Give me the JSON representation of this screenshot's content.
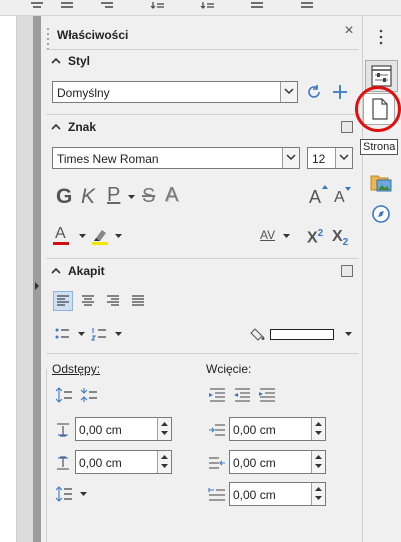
{
  "panel": {
    "title": "Właściwości",
    "close_glyph": "×"
  },
  "style_section": {
    "title": "Styl",
    "style_value": "Domyślny"
  },
  "char_section": {
    "title": "Znak",
    "font_name": "Times New Roman",
    "font_size": "12",
    "glyph_bold": "G",
    "glyph_italic": "K",
    "glyph_underline": "P",
    "glyph_strike": "S",
    "glyph_shadow": "A",
    "glyph_grow": "A",
    "glyph_shrink": "A",
    "glyph_fontcolor": "A",
    "glyph_spacing": "AV",
    "glyph_super": "X",
    "super_mark": "2",
    "glyph_sub": "X",
    "sub_mark": "2"
  },
  "para_section": {
    "title": "Akapit",
    "spacing_label": "Odstępy:",
    "indent_label": "Wcięcie:",
    "above_value": "0,00 cm",
    "below_value": "0,00 cm",
    "before_value": "0,00 cm",
    "after_value": "0,00 cm",
    "first_line_value": "0,00 cm"
  },
  "tabbar": {
    "tooltip": "Strona"
  },
  "icons": {
    "properties_tab": "sliders-icon",
    "page_tab": "page-icon",
    "gallery_tab": "gallery-icon",
    "navigator_tab": "compass-icon"
  },
  "colors": {
    "font_color": "#d01010",
    "highlight_color": "#f5e600",
    "annotation_circle": "#e01010"
  }
}
